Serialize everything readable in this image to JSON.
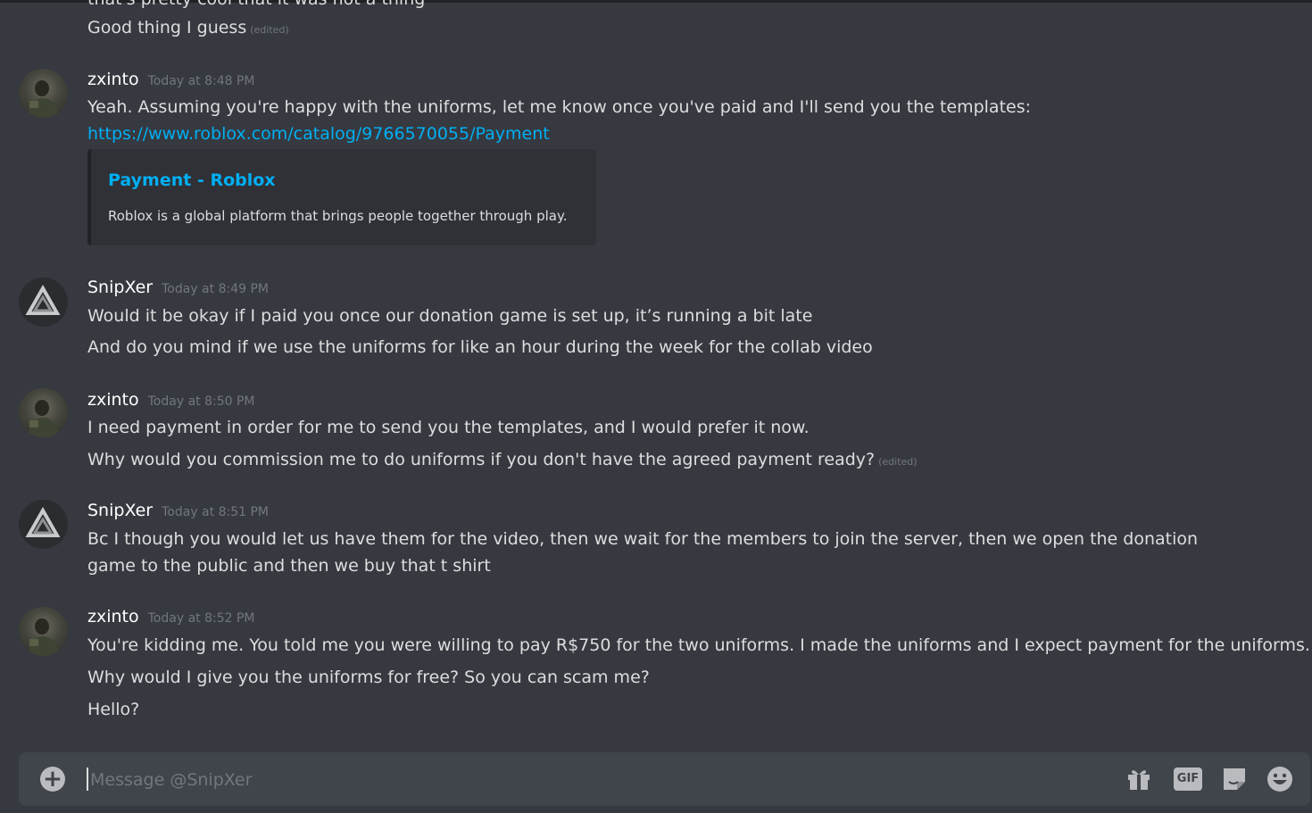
{
  "messages": {
    "cut_off_text": "that's pretty cool that it was not a thing",
    "top_line": {
      "text": "Good thing I guess",
      "edited": "(edited)"
    },
    "group1": {
      "username": "zxinto",
      "timestamp": "Today at 8:48 PM",
      "line1": "Yeah. Assuming you're happy with the uniforms, let me know once you've paid and I'll send you the templates:",
      "link": "https://www.roblox.com/catalog/9766570055/Payment",
      "embed": {
        "title": "Payment - Roblox",
        "description": "Roblox is a global platform that brings people together through play."
      }
    },
    "group2": {
      "username": "SnipXer",
      "timestamp": "Today at 8:49 PM",
      "line1": "Would it be okay if I paid you once our donation game is set up, it’s running a bit late",
      "line2": "And do you mind if we use the uniforms for like an hour during the week for the collab video"
    },
    "group3": {
      "username": "zxinto",
      "timestamp": "Today at 8:50 PM",
      "line1": "I need payment in order for me to send you the templates, and I would prefer it now.",
      "line2": "Why would you commission me to do uniforms if you don't have the agreed payment ready?",
      "line2_edited": "(edited)"
    },
    "group4": {
      "username": "SnipXer",
      "timestamp": "Today at 8:51 PM",
      "line1": "Bc I though you would let us have them for the video, then we wait for the members to join the server, then we open the donation game to the public and then we buy that t shirt"
    },
    "group5": {
      "username": "zxinto",
      "timestamp": "Today at 8:52 PM",
      "line1": "You're kidding me. You told me you were willing to pay R$750 for the two uniforms. I made the uniforms and I expect payment for the uniforms.",
      "line2": "Why would I give you the uniforms for free? So you can scam me?",
      "line3": "Hello?"
    }
  },
  "composer": {
    "placeholder": "Message @SnipXer",
    "add_icon": "plus-circle-icon",
    "gift_icon": "gift-icon",
    "gif_label": "GIF",
    "sticker_icon": "sticker-icon",
    "emoji_icon": "emoji-icon"
  },
  "colors": {
    "background": "#36393f",
    "composer": "#40444b",
    "link": "#00aff4",
    "muted": "#72767d"
  }
}
